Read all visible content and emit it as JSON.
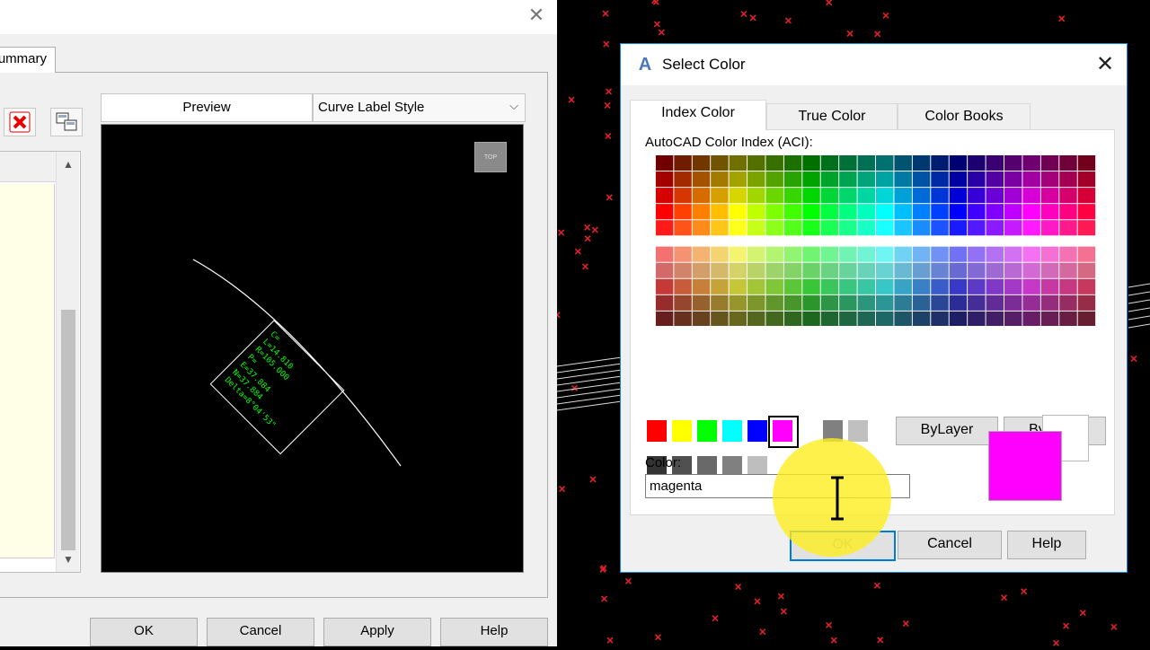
{
  "left_dialog": {
    "tab_label": "Summary",
    "preview_tab": "Preview",
    "style_select": "Curve Label Style",
    "viewcube_label": "TOP",
    "buttons": {
      "ok": "OK",
      "cancel": "Cancel",
      "apply": "Apply",
      "help": "Help"
    },
    "curve_label_lines": [
      "C=",
      "L=14.810",
      "R=105.000",
      "P=",
      "E=37.884",
      "N=37.884",
      "Delta=8°04'53\""
    ],
    "label_color": "#00ff00"
  },
  "select_color": {
    "title": "Select Color",
    "tabs": [
      "Index Color",
      "True Color",
      "Color Books"
    ],
    "aci_label": "AutoCAD Color Index (ACI):",
    "standard_colors": [
      "#ff0000",
      "#ffff00",
      "#00ff00",
      "#00ffff",
      "#0000ff",
      "#ff00ff",
      "#ffffff",
      "#808080",
      "#c0c0c0"
    ],
    "gray_shades": [
      "#333333",
      "#505050",
      "#696969",
      "#808080",
      "#bebebe",
      "#ffffff"
    ],
    "bylayer": "ByLayer",
    "byblock": "ByBlock",
    "color_label": "Color:",
    "color_value": "magenta",
    "new_color": "#ff00ff",
    "old_color": "#ffffff",
    "buttons": {
      "ok": "OK",
      "cancel": "Cancel",
      "help": "Help"
    }
  }
}
